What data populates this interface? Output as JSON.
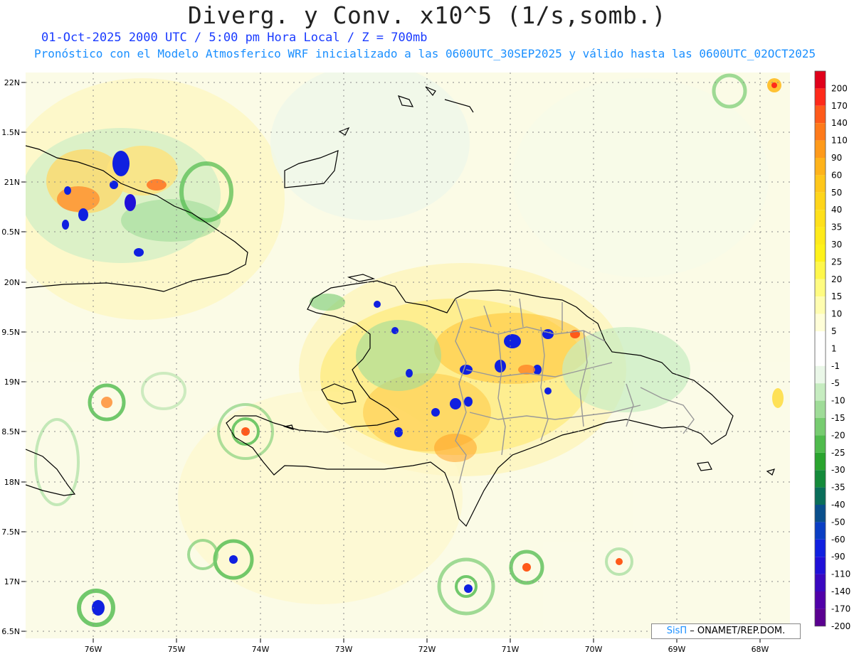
{
  "header": {
    "title": "Diverg. y Conv. x10^5 (1/s,somb.)",
    "line1": "01-Oct-2025  2000 UTC / 5:00 pm Hora Local / Z = 700mb",
    "line2": "Pronóstico con el Modelo Atmosferico WRF inicializado a las 0600UTC_30SEP2025 y válido hasta las  0600UTC_02OCT2025"
  },
  "axes": {
    "lat_labels": [
      "22N",
      "1.5N",
      "21N",
      "0.5N",
      "20N",
      "9.5N",
      "19N",
      "8.5N",
      "18N",
      "7.5N",
      "17N",
      "6.5N"
    ],
    "lon_labels": [
      "76W",
      "75W",
      "74W",
      "73W",
      "72W",
      "71W",
      "70W",
      "69W",
      "68W"
    ]
  },
  "colorbar": {
    "levels": [
      "200",
      "170",
      "140",
      "110",
      "90",
      "60",
      "50",
      "40",
      "35",
      "30",
      "25",
      "20",
      "15",
      "10",
      "5",
      "1",
      "-1",
      "-5",
      "-10",
      "-15",
      "-20",
      "-25",
      "-30",
      "-35",
      "-40",
      "-50",
      "-60",
      "-90",
      "-110",
      "-140",
      "-170",
      "-200"
    ],
    "colors": [
      "#e0001a",
      "#ff2a1a",
      "#ff5a1a",
      "#ff7a1a",
      "#ff9a1a",
      "#ffb31a",
      "#ffc71a",
      "#ffd51a",
      "#ffe01a",
      "#ffea1a",
      "#fff21a",
      "#fff74a",
      "#fffb80",
      "#fffdb0",
      "#fffed8",
      "#ffffff",
      "#ffffff",
      "#eaf7e8",
      "#c6ecc0",
      "#9fdc98",
      "#77cc70",
      "#4fbb4c",
      "#2aa42e",
      "#148a3a",
      "#0a6e5a",
      "#0a4f8c",
      "#0a3ec4",
      "#1020e0",
      "#2010d8",
      "#3a08c0",
      "#5000a8",
      "#5a0090"
    ]
  },
  "credit": {
    "brand": "SisΠ",
    "text": "– ONAMET/REP.DOM."
  }
}
